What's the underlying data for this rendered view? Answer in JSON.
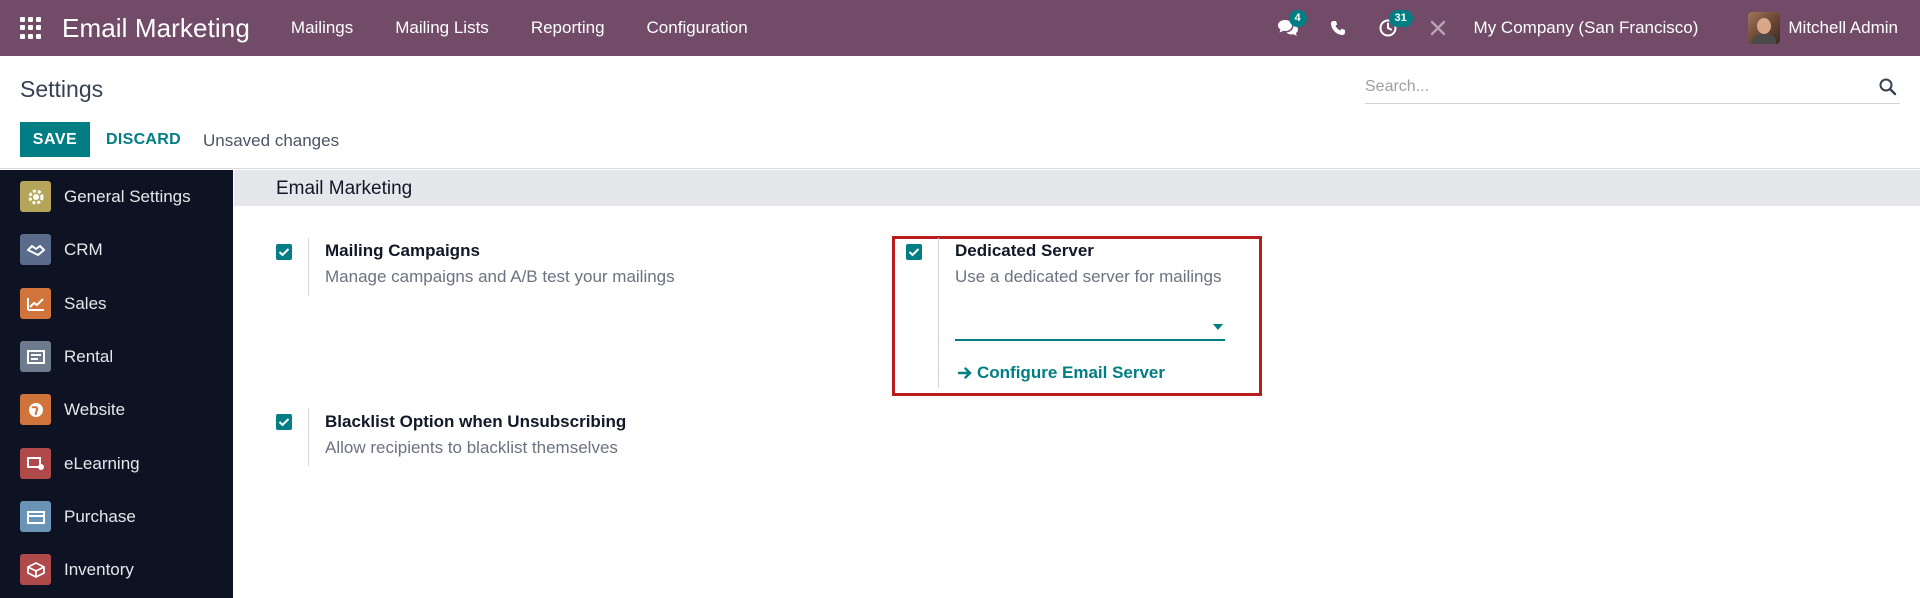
{
  "navbar": {
    "brand": "Email Marketing",
    "menu": [
      "Mailings",
      "Mailing Lists",
      "Reporting",
      "Configuration"
    ],
    "messages_badge": "4",
    "activities_badge": "31",
    "company": "My Company (San Francisco)",
    "user": "Mitchell Admin"
  },
  "control_panel": {
    "title": "Settings",
    "search_placeholder": "Search...",
    "save_label": "SAVE",
    "discard_label": "DISCARD",
    "status": "Unsaved changes"
  },
  "sidebar": {
    "items": [
      {
        "label": "General Settings",
        "icon": "gear-icon",
        "color": "#b5a55a"
      },
      {
        "label": "CRM",
        "icon": "handshake-icon",
        "color": "#5b6b8c"
      },
      {
        "label": "Sales",
        "icon": "chart-icon",
        "color": "#d1743b"
      },
      {
        "label": "Rental",
        "icon": "rental-icon",
        "color": "#6d7b8c"
      },
      {
        "label": "Website",
        "icon": "globe-icon",
        "color": "#d1743b"
      },
      {
        "label": "eLearning",
        "icon": "elearning-icon",
        "color": "#b04a4a"
      },
      {
        "label": "Purchase",
        "icon": "card-icon",
        "color": "#6b93b5"
      },
      {
        "label": "Inventory",
        "icon": "box-icon",
        "color": "#b04a4a"
      }
    ]
  },
  "section": {
    "title": "Email Marketing",
    "settings": {
      "mailing_campaigns": {
        "title": "Mailing Campaigns",
        "description": "Manage campaigns and A/B test your mailings",
        "checked": true
      },
      "dedicated_server": {
        "title": "Dedicated Server",
        "description": "Use a dedicated server for mailings",
        "checked": true,
        "select_value": "",
        "link": "Configure Email Server"
      },
      "blacklist": {
        "title": "Blacklist Option when Unsubscribing",
        "description": "Allow recipients to blacklist themselves",
        "checked": true
      }
    }
  },
  "colors": {
    "navbar": "#714b67",
    "accent": "#017e84",
    "sidebar": "#0d1323",
    "highlight": "#b91c1c"
  }
}
